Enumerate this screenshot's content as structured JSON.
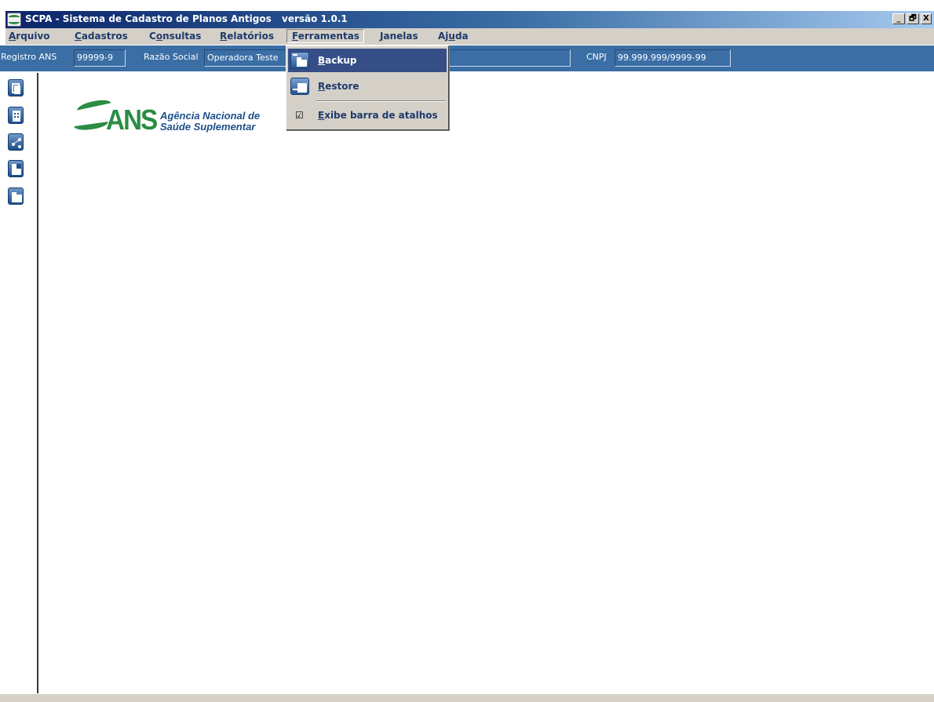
{
  "window": {
    "title": "SCPA - Sistema de Cadastro de Planos Antigos",
    "version": "versão 1.0.1",
    "controls": [
      "_",
      "🗗",
      "X"
    ]
  },
  "menubar": {
    "items": [
      {
        "label": "Arquivo",
        "key": "A"
      },
      {
        "label": "Cadastros",
        "key": "C"
      },
      {
        "label": "Consultas",
        "key": "o"
      },
      {
        "label": "Relatórios",
        "key": "R"
      },
      {
        "label": "Ferramentas",
        "key": "F"
      },
      {
        "label": "Janelas",
        "key": "J"
      },
      {
        "label": "Ajuda",
        "key": "u"
      }
    ]
  },
  "registry": {
    "registro_label": "Registro ANS",
    "registro_value": "99999-9",
    "razao_label": "Razão Social",
    "razao_value": "Operadora Teste",
    "cnpj_label": "CNPJ",
    "cnpj_value": "99.999.999/9999-99"
  },
  "dropdown": {
    "items": [
      {
        "label": "Backup",
        "icon": "backup-folder-icon",
        "selected": true
      },
      {
        "label": "Restore",
        "icon": "restore-icon",
        "selected": false
      },
      {
        "label": "Exibe barra de atalhos",
        "icon": "checkmark-icon",
        "checked": true
      }
    ]
  },
  "toolbar": {
    "buttons": [
      "copy-icon",
      "building-icon",
      "network-icon",
      "form-icon",
      "folder-icon"
    ]
  },
  "logo": {
    "brand": "ANS",
    "line1": "Agência Nacional de",
    "line2": "Saúde Suplementar"
  },
  "colors": {
    "title_gradient_start": "#0a246a",
    "title_gradient_end": "#a6caf0",
    "menu_text": "#1f3a6b",
    "registry_bar": "#3a6ea5",
    "selection": "#364e86",
    "logo_green": "#2b8c43",
    "logo_blue": "#1c4f8a"
  }
}
